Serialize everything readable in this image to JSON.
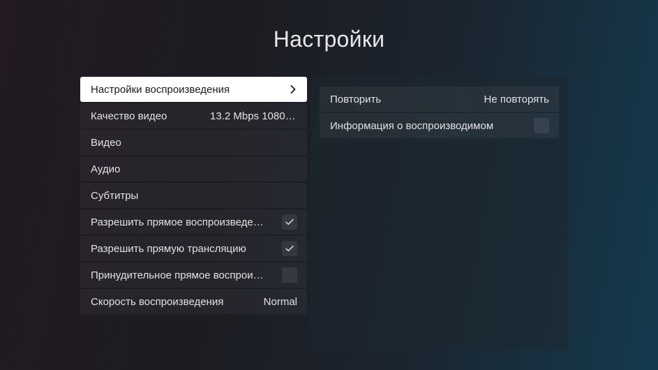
{
  "header": {
    "title": "Настройки"
  },
  "left_menu": {
    "items": [
      {
        "label": "Настройки воспроизведения",
        "type": "submenu",
        "active": true,
        "icon": "chevron-right-icon"
      },
      {
        "label": "Качество видео",
        "value": "13.2 Mbps 1080p..."
      },
      {
        "label": "Видео"
      },
      {
        "label": "Аудио"
      },
      {
        "label": "Субтитры"
      },
      {
        "label": "Разрешить прямое воспроизведен...",
        "type": "checkbox",
        "checked": true
      },
      {
        "label": "Разрешить прямую трансляцию",
        "type": "checkbox",
        "checked": true
      },
      {
        "label": "Принудительное прямое воспроиз...",
        "type": "checkbox",
        "checked": false
      },
      {
        "label": "Скорость воспроизведения",
        "value": "Normal"
      }
    ]
  },
  "right_panel": {
    "items": [
      {
        "label": "Повторить",
        "value": "Не повторять"
      },
      {
        "label": "Информация о воспроизводимом",
        "type": "checkbox",
        "checked": false
      }
    ]
  },
  "colors": {
    "active_row_bg": "#ffffff",
    "active_row_text": "#1a1a1a",
    "text": "#e2e2e4"
  },
  "icons": {
    "check": "checkmark-icon",
    "chevron": "chevron-right-icon"
  }
}
